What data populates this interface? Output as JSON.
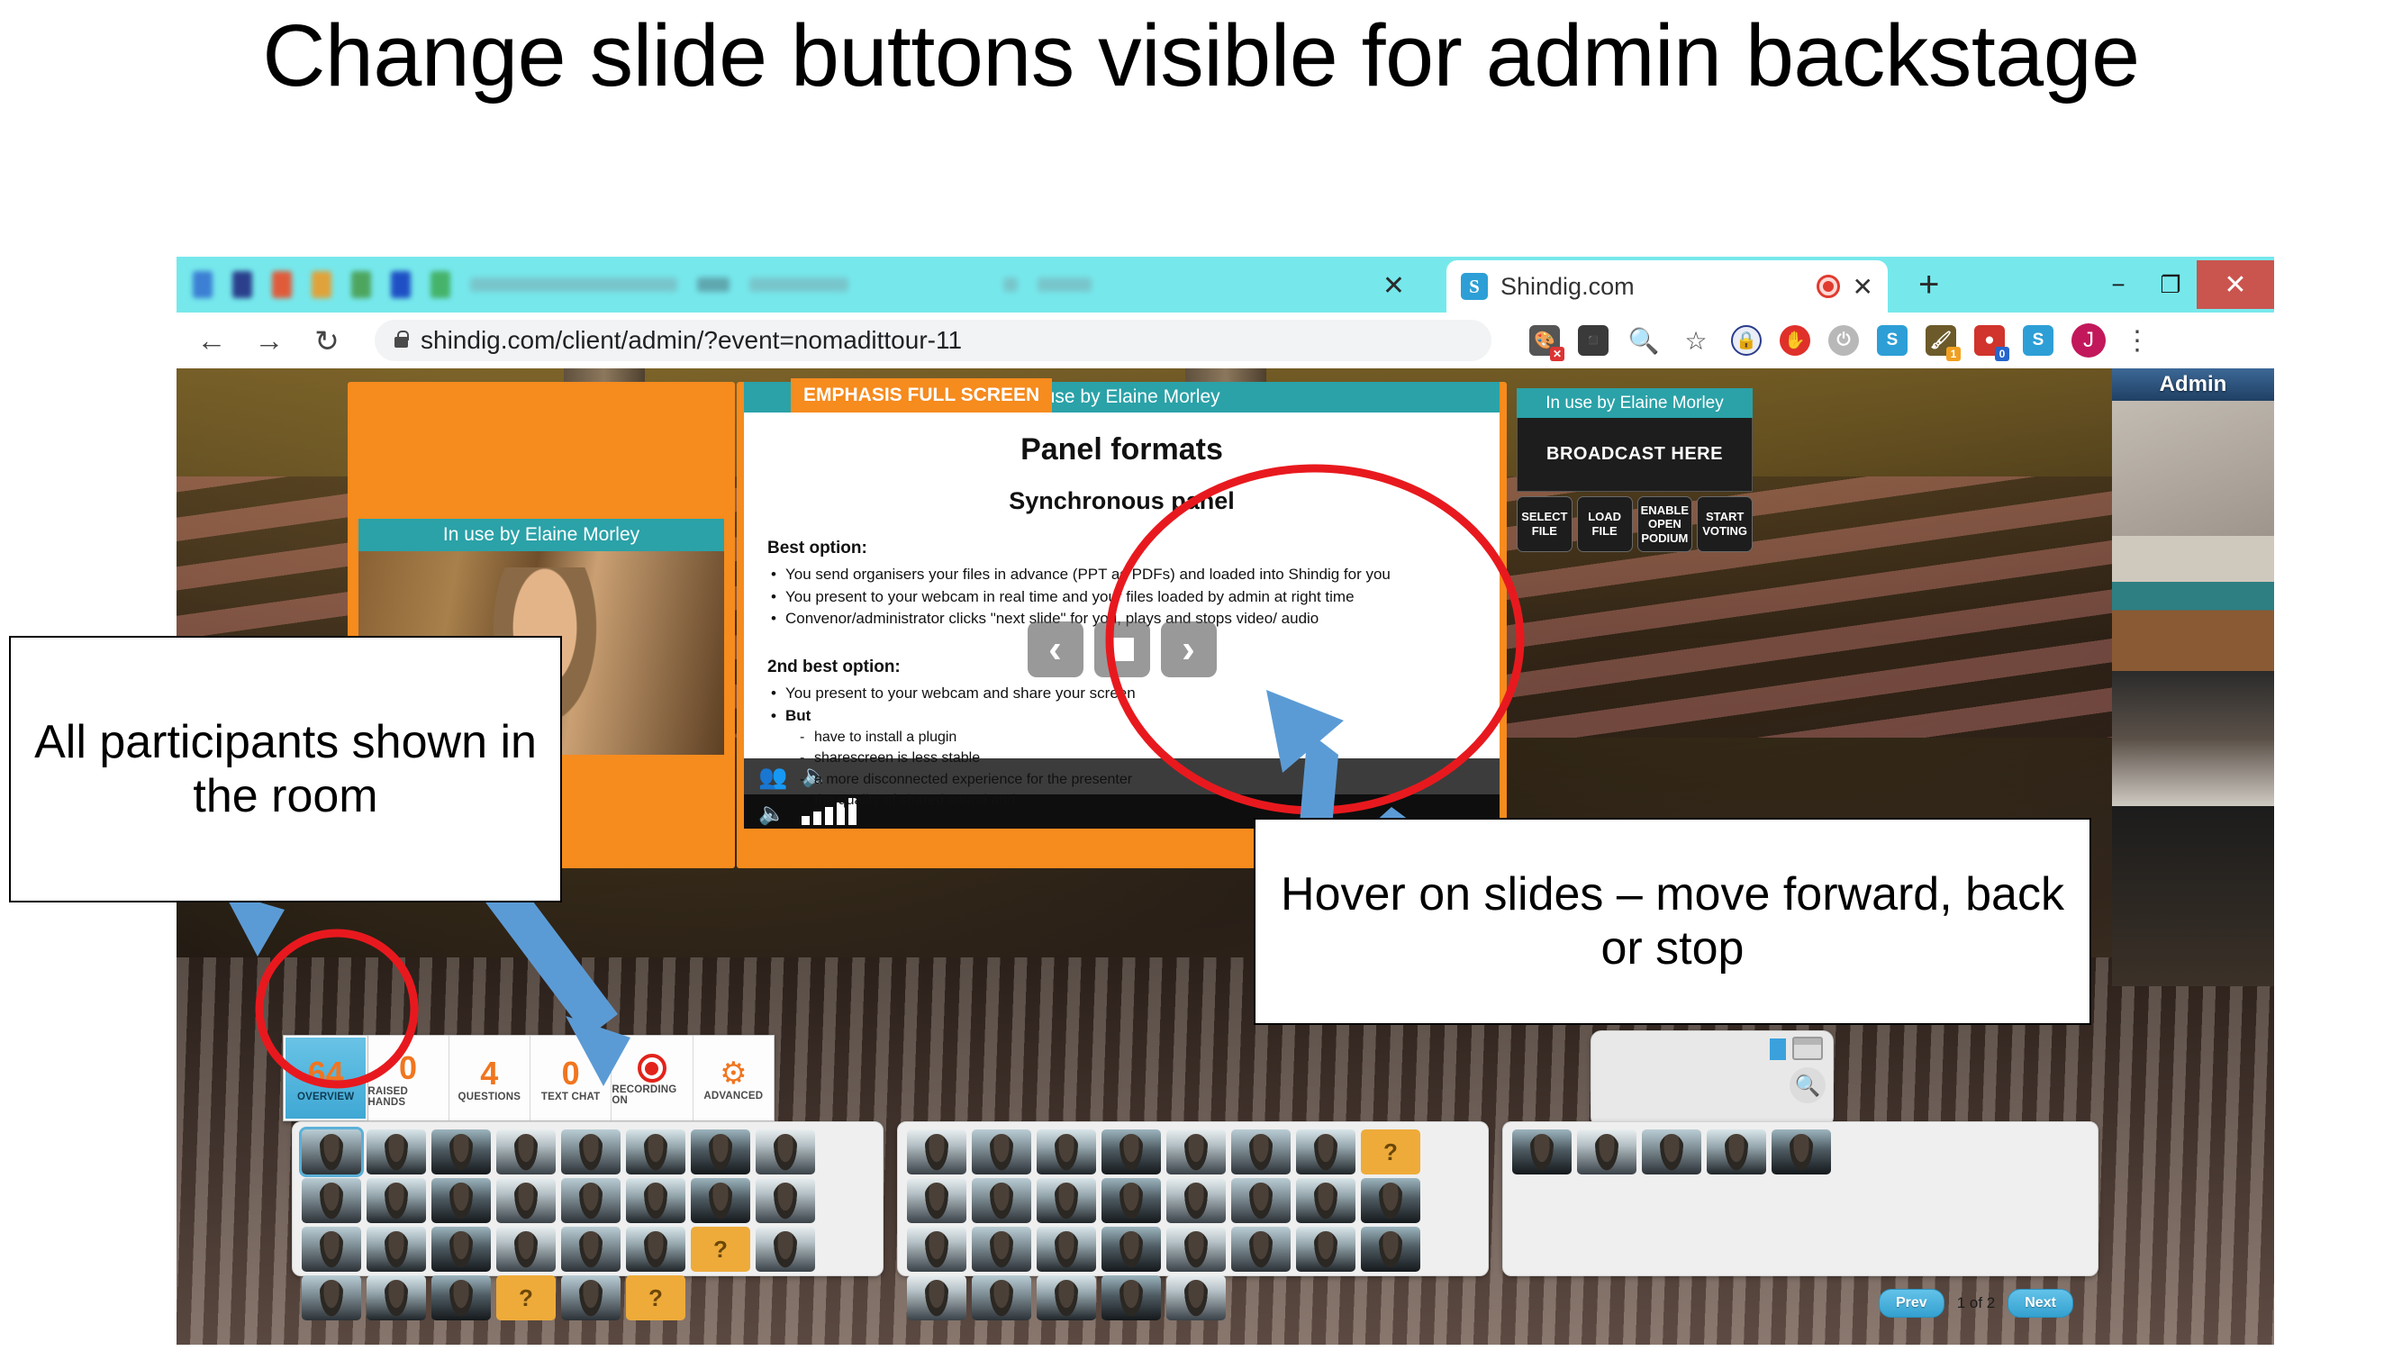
{
  "slide": {
    "title": "Change slide buttons visible for admin backstage"
  },
  "browser": {
    "active_tab": {
      "title": "Shindig.com",
      "favicon_letter": "S"
    },
    "new_tab_label": "+",
    "close_label": "✕",
    "minimize_label": "−",
    "restore_label": "❐",
    "window_close_label": "✕",
    "nav": {
      "back": "←",
      "forward": "→",
      "reload": "↻"
    },
    "url": "shindig.com/client/admin/?event=nomadittour-11",
    "extensions": [
      "palette-ext",
      "video-camera-ext",
      "zoom-out-ext",
      "bookmark-star",
      "lock-ext",
      "stop-ext",
      "power-ext",
      "shindig-ext-1",
      "paint-ext",
      "record-ext",
      "shindig-ext-2"
    ],
    "profile_initial": "J",
    "menu_label": "⋮"
  },
  "app": {
    "admin_label": "Admin",
    "presenter_panel": {
      "in_use_label": "In use by Elaine Morley"
    },
    "slide_viewer": {
      "emphasis_badge": "EMPHASIS FULL SCREEN",
      "in_use_label": "In use by Elaine Morley",
      "heading": "Panel formats",
      "subheading": "Synchronous panel",
      "best_option_label": "Best option:",
      "best_option_items": [
        "You send organisers your files in advance (PPT as PDFs) and loaded into Shindig for you",
        "You present to your webcam in real time and your files loaded by admin at right time",
        "Convenor/administrator clicks \"next slide\" for you, plays and stops video/ audio"
      ],
      "second_option_label": "2nd best option:",
      "second_option_items": [
        "You present to your webcam and share your screen",
        "But"
      ],
      "second_option_subitems": [
        "have to install a plugin",
        "sharescreen is less stable",
        "a more disconnected experience for the presenter",
        "the quality of shared sound and"
      ],
      "controls": {
        "prev": "‹",
        "stop": "■",
        "next": "›"
      }
    },
    "broadcast_panel": {
      "in_use_label": "In use by Elaine Morley",
      "broadcast_here_label": "BROADCAST HERE",
      "buttons": [
        {
          "line1": "SELECT",
          "line2": "FILE",
          "line3": ""
        },
        {
          "line1": "LOAD",
          "line2": "FILE",
          "line3": ""
        },
        {
          "line1": "ENABLE",
          "line2": "OPEN",
          "line3": "PODIUM"
        },
        {
          "line1": "START",
          "line2": "VOTING",
          "line3": ""
        }
      ]
    },
    "toolbar": [
      {
        "value": "64",
        "label": "OVERVIEW",
        "icon": "",
        "active": true
      },
      {
        "value": "0",
        "label": "RAISED HANDS",
        "icon": "",
        "active": false
      },
      {
        "value": "4",
        "label": "QUESTIONS",
        "icon": "",
        "active": false
      },
      {
        "value": "0",
        "label": "TEXT CHAT",
        "icon": "",
        "active": false
      },
      {
        "value": "",
        "label": "RECORDING ON",
        "icon": "record-icon",
        "active": false
      },
      {
        "value": "",
        "label": "ADVANCED",
        "icon": "gear-icon",
        "active": false
      }
    ],
    "participant_groups": [
      {
        "count": 30,
        "question_indices": [
          22,
          27,
          29
        ]
      },
      {
        "count": 29,
        "question_indices": [
          7
        ]
      },
      {
        "count": 5,
        "question_indices": []
      }
    ],
    "pager": {
      "prev": "Prev",
      "status": "1 of 2",
      "next": "Next"
    },
    "mini_panel": {
      "search_icon": "search-icon",
      "window_icon": "window-icon"
    }
  },
  "annotations": {
    "left": "All participants shown in the room",
    "right": "Hover on slides – move forward, back or stop"
  },
  "colors": {
    "chrome_tabbar": "#76e8ec",
    "orange_panel": "#f68b1e",
    "teal_bar": "#2aa2a8",
    "accent_orange": "#f1751f",
    "active_blue": "#3fa8d4",
    "annotation_red": "#e8191e",
    "annotation_blue": "#5b9bd5",
    "question_amber": "#eeab3a"
  }
}
